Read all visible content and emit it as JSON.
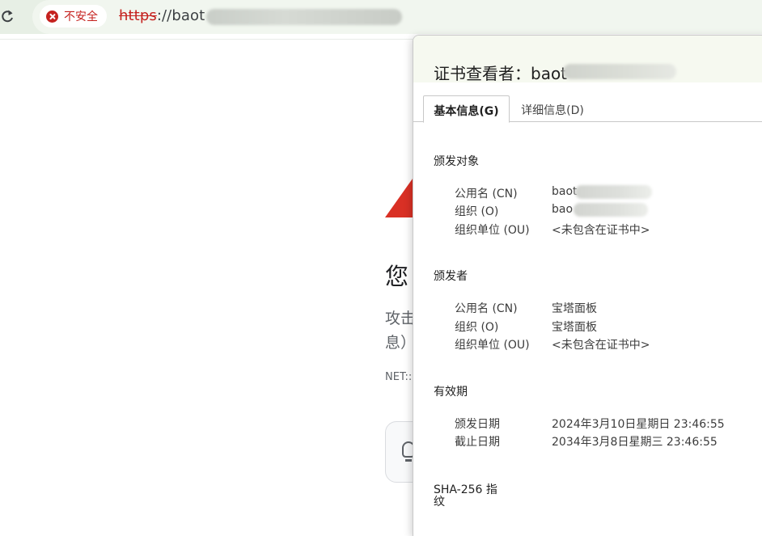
{
  "browser": {
    "security_label": "不安全",
    "url_scheme": "https",
    "url_rest": "://baot"
  },
  "page": {
    "heading": "您",
    "body_line1": "攻击",
    "body_line2": "息）",
    "error_code": "NET::"
  },
  "dialog": {
    "title": "证书查看者：baot",
    "tabs": [
      "基本信息(G)",
      "详细信息(D)"
    ],
    "subject": {
      "heading": "颁发对象",
      "rows": [
        {
          "label": "公用名 (CN)",
          "value": "baot"
        },
        {
          "label": "组织 (O)",
          "value": "bao"
        },
        {
          "label": "组织单位 (OU)",
          "value": "<未包含在证书中>"
        }
      ]
    },
    "issuer": {
      "heading": "颁发者",
      "rows": [
        {
          "label": "公用名 (CN)",
          "value": "宝塔面板"
        },
        {
          "label": "组织 (O)",
          "value": "宝塔面板"
        },
        {
          "label": "组织单位 (OU)",
          "value": "<未包含在证书中>"
        }
      ]
    },
    "validity": {
      "heading": "有效期",
      "rows": [
        {
          "label": "颁发日期",
          "value": "2024年3月10日星期日 23:46:55"
        },
        {
          "label": "截止日期",
          "value": "2034年3月8日星期三 23:46:55"
        }
      ]
    },
    "fingerprint_heading_line1": "SHA-256 指",
    "fingerprint_heading_line2": "纹"
  }
}
